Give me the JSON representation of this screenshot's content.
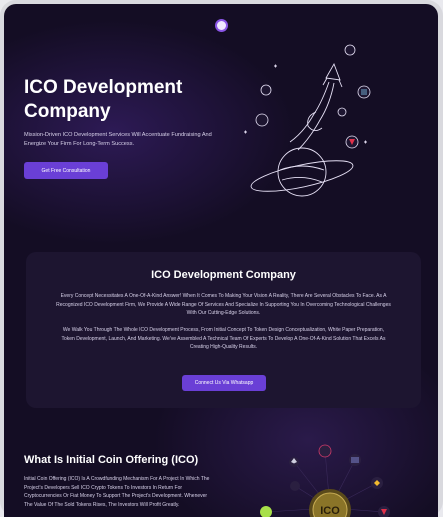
{
  "hero": {
    "title": "ICO Development Company",
    "subtitle": "Mission-Driven ICO Development Services Will Accentuate Fundraising And Energize Your Firm For Long-Term Success.",
    "cta_label": "Get Free Consultation"
  },
  "about_card": {
    "title": "ICO Development Company",
    "paragraph1": "Every Concept Necessitates A One-Of-A-Kind Answer! When It Comes To Making Your Vision A Reality, There Are Several Obstacles To Face. As A Recognized ICO Development Firm, We Provide A Wide Range Of Services And Specialize In Supporting You In Overcoming Technological Challenges With Our Cutting-Edge Solutions.",
    "paragraph2": "We Walk You Through The Whole ICO Development Process, From Initial Concept To Token Design Conceptualization, White Paper Preparation, Token Development, Launch, And Marketing. We've Assembled A Technical Team Of Experts To Develop A One-Of-A-Kind Solution That Excels As Creating High-Quality Results.",
    "cta_label": "Connect Us Via Whatsapp"
  },
  "ico_section": {
    "title": "What Is Initial Coin Offering (ICO)",
    "paragraph": "Initial Coin Offering (ICO) Is A Crowdfunding Mechanism For A Project In Which The Project's Developers Sell ICO Crypto Tokens To Investors In Return For Cryptocurrencies Or Fiat Money To Support The Project's Development. Whenever The Value Of The Sold Tokens Rises, The Investors Will Profit Greatly.",
    "coin_label": "ICO"
  },
  "colors": {
    "background": "#140d24",
    "accent": "#6a3fd6",
    "card": "#1d1530"
  }
}
